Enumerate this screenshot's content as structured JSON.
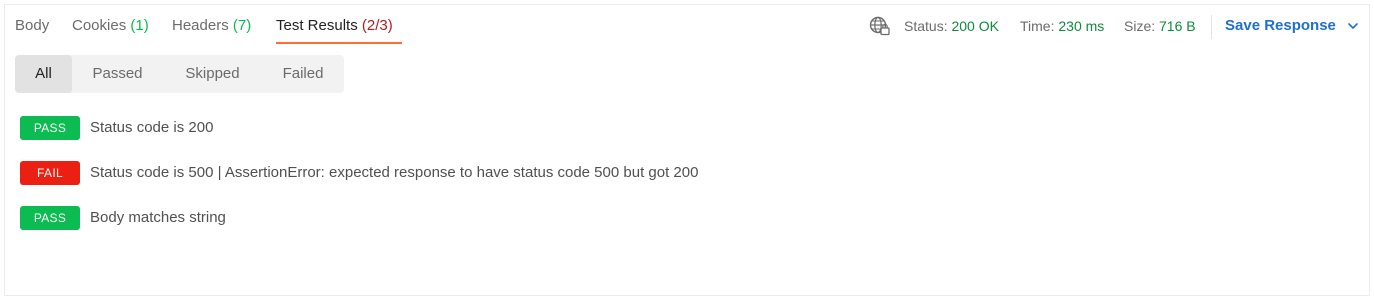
{
  "tabs": [
    {
      "label": "Body",
      "count": ""
    },
    {
      "label": "Cookies",
      "count": "(1)"
    },
    {
      "label": "Headers",
      "count": "(7)"
    },
    {
      "label": "Test Results",
      "count": "(2/3)"
    }
  ],
  "active_tab": "Test Results",
  "meta": {
    "status_label": "Status:",
    "status_value": "200 OK",
    "time_label": "Time:",
    "time_value": "230 ms",
    "size_label": "Size:",
    "size_value": "716 B"
  },
  "save_response_label": "Save Response",
  "filters": [
    {
      "label": "All",
      "active": true
    },
    {
      "label": "Passed",
      "active": false
    },
    {
      "label": "Skipped",
      "active": false
    },
    {
      "label": "Failed",
      "active": false
    }
  ],
  "results": [
    {
      "status": "PASS",
      "text": "Status code is 200"
    },
    {
      "status": "FAIL",
      "text": "Status code is 500 | AssertionError: expected response to have status code 500 but got 200"
    },
    {
      "status": "PASS",
      "text": "Body matches string"
    }
  ],
  "icons": {
    "network": "globe-lock-icon",
    "dropdown": "chevron-down-icon"
  },
  "colors": {
    "pass": "#0cbb52",
    "fail": "#eb2013",
    "accent": "#ff6c37",
    "link": "#1f6fd0"
  }
}
